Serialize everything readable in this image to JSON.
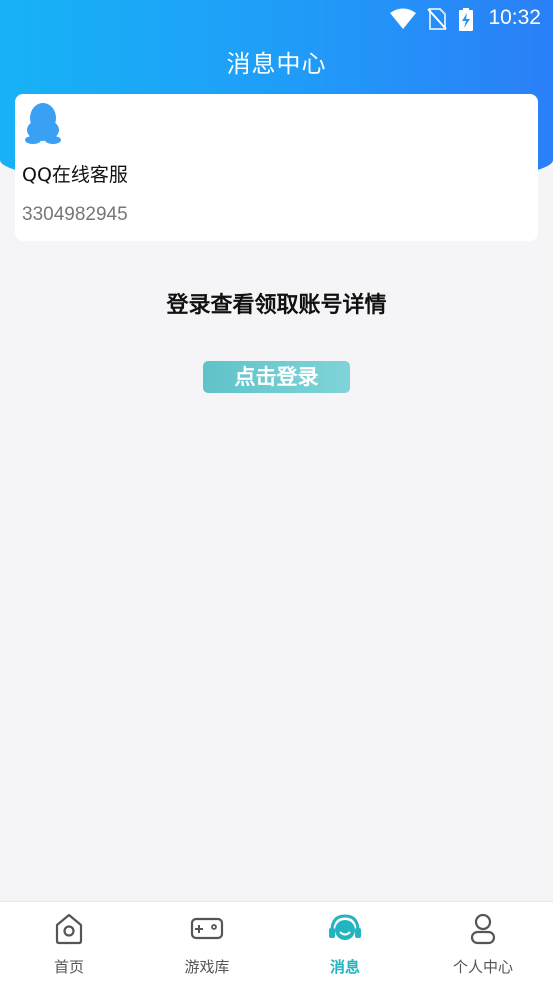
{
  "status_bar": {
    "time": "10:32",
    "icons": [
      "wifi-icon",
      "no-sim-icon",
      "battery-charging-icon"
    ]
  },
  "header": {
    "title": "消息中心"
  },
  "customer_service": {
    "icon": "qq-penguin-icon",
    "name": "QQ在线客服",
    "number": "3304982945"
  },
  "main": {
    "login_prompt": "登录查看领取账号详情",
    "login_button": "点击登录"
  },
  "tabbar": {
    "active_color": "#22b4c0",
    "tabs": [
      {
        "label": "首页",
        "icon": "home-icon",
        "active": false
      },
      {
        "label": "游戏库",
        "icon": "gamepad-icon",
        "active": false
      },
      {
        "label": "消息",
        "icon": "headset-message-icon",
        "active": true
      },
      {
        "label": "个人中心",
        "icon": "user-icon",
        "active": false
      }
    ]
  }
}
